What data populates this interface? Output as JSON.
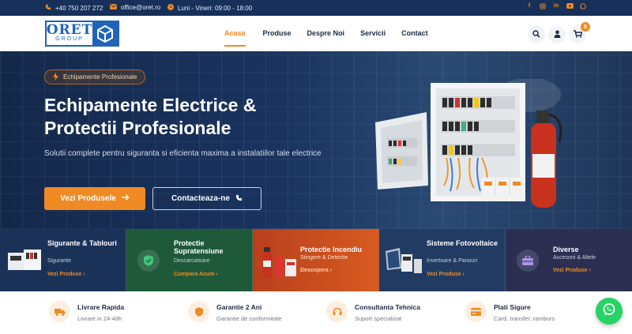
{
  "topbar": {
    "phone": "+40 750 207 272",
    "email": "office@oret.ro",
    "hours": "Luni - Vineri: 09:00 - 18:00",
    "social": [
      "facebook-icon",
      "instagram-icon",
      "linkedin-icon",
      "youtube-icon",
      "whatsapp-icon"
    ]
  },
  "header": {
    "logo_top": "ORET",
    "logo_bottom": "GROUP",
    "nav": [
      {
        "label": "Acasa",
        "active": true
      },
      {
        "label": "Produse",
        "active": false
      },
      {
        "label": "Despre Noi",
        "active": false
      },
      {
        "label": "Servicii",
        "active": false
      },
      {
        "label": "Contact",
        "active": false
      }
    ],
    "cart_count": "0"
  },
  "hero": {
    "badge": "Echipamente Profesionale",
    "title_line1": "Echipamente Electrice &",
    "title_line2": "Protectii Profesionale",
    "subtitle": "Solutii complete pentru siguranta si eficienta maxima a instalatiilor tale electrice",
    "primary_button": "Vezi Produsele",
    "secondary_button": "Contacteaza-ne"
  },
  "categories": [
    {
      "title": "Sigurante & Tablouri",
      "desc": "Sigurante",
      "link": "Vezi Produse",
      "bg": "#1b3258"
    },
    {
      "title": "Protectie Supratensiune",
      "desc": "Descarcatoare",
      "link": "Cumpara Acum",
      "bg": "#1e5a3a"
    },
    {
      "title": "Protectie Incendiu",
      "desc": "Stingere & Detectie",
      "link": "Descopera",
      "bg": "#c8481e"
    },
    {
      "title": "Sisteme Fotovoltaice",
      "desc": "Invertoare & Panouri",
      "link": "Vezi Produse",
      "bg": "#223b63"
    },
    {
      "title": "Diverse",
      "desc": "Accesorii & Altele",
      "link": "Vezi Produse",
      "bg": "#2c2f52"
    }
  ],
  "features": [
    {
      "title": "Livrare Rapida",
      "desc": "Livrare in 24-48h",
      "icon": "truck-icon"
    },
    {
      "title": "Garantie 2 Ani",
      "desc": "Garantie de conformitate",
      "icon": "shield-icon"
    },
    {
      "title": "Consultanta Tehnica",
      "desc": "Suport specializat",
      "icon": "headset-icon"
    },
    {
      "title": "Plati Sigure",
      "desc": "Card, transfer, ramburs",
      "icon": "card-icon"
    }
  ],
  "colors": {
    "accent": "#f08a24",
    "navy": "#16305a",
    "brand_blue": "#1f64b8",
    "whatsapp": "#25d366"
  }
}
